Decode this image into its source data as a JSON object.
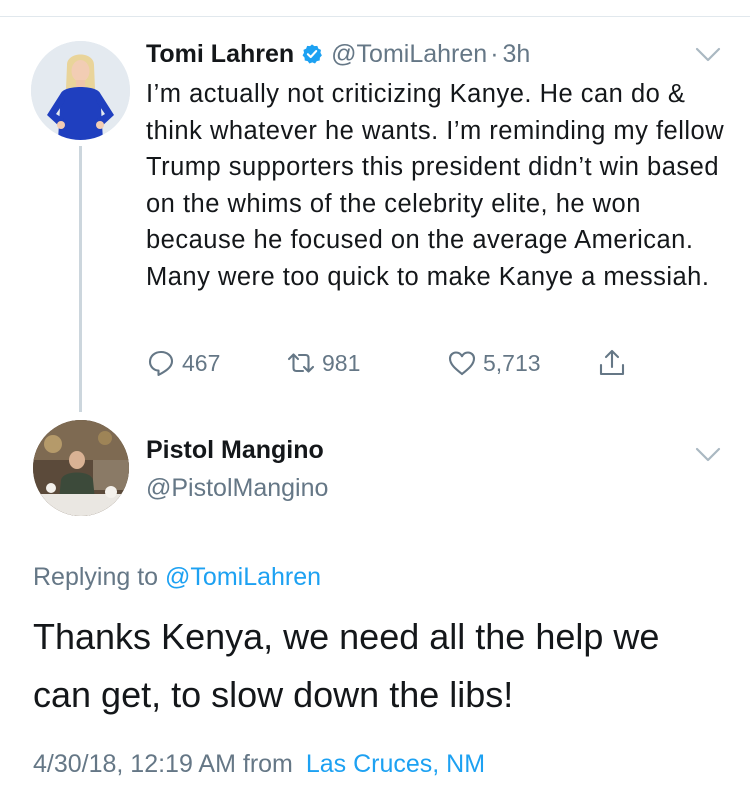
{
  "tweet": {
    "author_name": "Tomi Lahren",
    "handle": "@TomiLahren",
    "separator": "·",
    "time": "3h",
    "text": "I’m actually not criticizing Kanye. He can do & think whatever he wants. I’m reminding my fellow Trump supporters this president didn’t win based on the whims of the celebrity elite, he won because he focused on the average American. Many were too quick to make Kanye a messiah.",
    "reply_count": "467",
    "retweet_count": "981",
    "like_count": "5,713"
  },
  "reply": {
    "author_name": "Pistol Mangino",
    "handle": "@PistolMangino",
    "replying_prefix": "Replying to",
    "replying_to": "@TomiLahren",
    "text": "Thanks Kenya, we need all the help we can get, to slow down the libs!",
    "timestamp": "4/30/18, 12:19 AM from",
    "location": "Las Cruces, NM"
  },
  "colors": {
    "link": "#1da1f2",
    "secondary_text": "#657786",
    "primary_text": "#14171a",
    "thread_line": "#ccd6dd"
  },
  "icons": {
    "verified": "verified-badge-icon",
    "caret": "chevron-down-icon",
    "reply": "reply-bubble-icon",
    "retweet": "retweet-icon",
    "like": "heart-icon",
    "share": "share-icon"
  }
}
